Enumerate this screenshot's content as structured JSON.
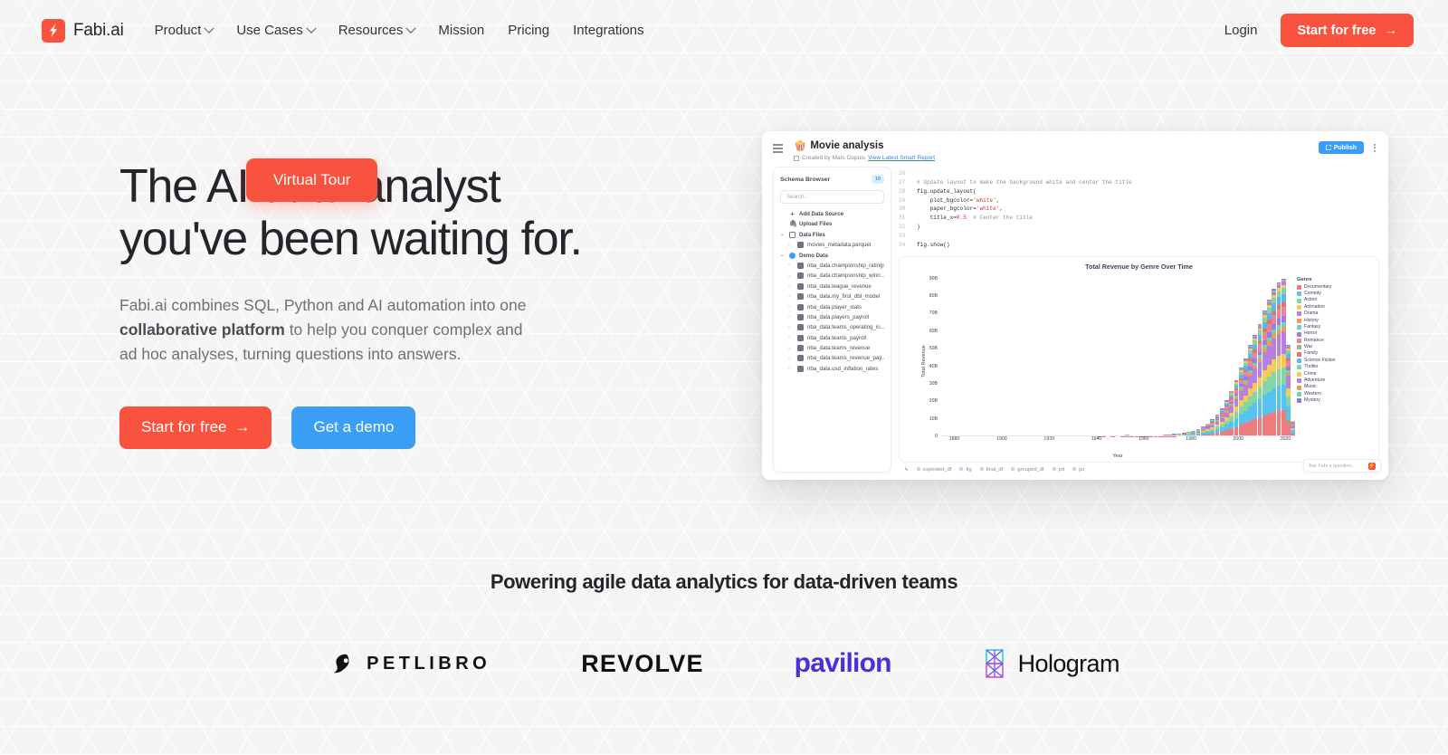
{
  "brand": {
    "name": "Fabi.ai",
    "mark_icon": "lightning-bolt-icon",
    "accent": "#f9523f"
  },
  "nav": {
    "links": [
      {
        "label": "Product",
        "has_caret": true
      },
      {
        "label": "Use Cases",
        "has_caret": true
      },
      {
        "label": "Resources",
        "has_caret": true
      },
      {
        "label": "Mission",
        "has_caret": false
      },
      {
        "label": "Pricing",
        "has_caret": false
      },
      {
        "label": "Integrations",
        "has_caret": false
      }
    ],
    "login_label": "Login",
    "cta_label": "Start for free",
    "cta_arrow": "→"
  },
  "hero": {
    "headline_line1": "The AI data analyst",
    "headline_line2": "you've been waiting for.",
    "sub_part1": "Fabi.ai combines SQL, Python and AI automation into one ",
    "sub_bold": "collaborative platform",
    "sub_part2": " to help you conquer complex and ad hoc analyses, turning questions into answers.",
    "primary_cta": "Start for free",
    "primary_cta_arrow": "→",
    "secondary_cta": "Get a demo"
  },
  "app": {
    "title": "Movie analysis",
    "title_emoji": "🍿",
    "created_by": "Created by Marc Dupuis",
    "report_link": "View Latest Smart Report",
    "publish_label": "Publish",
    "menu_icon": "hamburger-icon",
    "kebab_icon": "more-vertical-icon",
    "schema": {
      "heading": "Schema Browser",
      "badge": "10",
      "search_placeholder": "Search...",
      "tree": [
        {
          "label": "Add Data Source",
          "icon": "plus-icon",
          "type": "action",
          "indent": 0
        },
        {
          "label": "Upload Files",
          "icon": "paperclip-icon",
          "type": "action",
          "indent": 0
        },
        {
          "label": "Data Files",
          "icon": "file-icon",
          "type": "group",
          "indent": 0,
          "expanded": true
        },
        {
          "label": "movies_metadata.parquet",
          "icon": "table-icon",
          "type": "table",
          "indent": 1
        },
        {
          "label": "Demo Data",
          "icon": "database-icon",
          "type": "group",
          "indent": 0,
          "expanded": true
        },
        {
          "label": "nba_data.championship_ratings",
          "icon": "table-icon",
          "type": "table",
          "indent": 1
        },
        {
          "label": "nba_data.championship_winn...",
          "icon": "table-icon",
          "type": "table",
          "indent": 1
        },
        {
          "label": "nba_data.league_revenue",
          "icon": "table-icon",
          "type": "table",
          "indent": 1
        },
        {
          "label": "nba_data.my_first_dbt_model",
          "icon": "table-icon",
          "type": "table",
          "indent": 1
        },
        {
          "label": "nba_data.player_stats",
          "icon": "table-icon",
          "type": "table",
          "indent": 1
        },
        {
          "label": "nba_data.players_payroll",
          "icon": "table-icon",
          "type": "table",
          "indent": 1
        },
        {
          "label": "nba_data.teams_operating_in...",
          "icon": "table-icon",
          "type": "table",
          "indent": 1
        },
        {
          "label": "nba_data.teams_payroll",
          "icon": "table-icon",
          "type": "table",
          "indent": 1
        },
        {
          "label": "nba_data.teams_revenue",
          "icon": "table-icon",
          "type": "table",
          "indent": 1
        },
        {
          "label": "nba_data.teams_revenue_pay...",
          "icon": "table-icon",
          "type": "table",
          "indent": 1
        },
        {
          "label": "nba_data.usd_inflation_rates",
          "icon": "table-icon",
          "type": "table",
          "indent": 1
        }
      ]
    },
    "code_lines": [
      {
        "n": "26",
        "segments": []
      },
      {
        "n": "27",
        "segments": [
          {
            "t": "# Update layout to make the background white and center the title",
            "c": "cc"
          }
        ]
      },
      {
        "n": "28",
        "segments": [
          {
            "t": "fig.update_layout(",
            "c": "cp"
          }
        ]
      },
      {
        "n": "29",
        "segments": [
          {
            "t": "    plot_bgcolor=",
            "c": "cp"
          },
          {
            "t": "'white'",
            "c": "cs"
          },
          {
            "t": ",",
            "c": "cp"
          }
        ]
      },
      {
        "n": "30",
        "segments": [
          {
            "t": "    paper_bgcolor=",
            "c": "cp"
          },
          {
            "t": "'white'",
            "c": "cs"
          },
          {
            "t": ",",
            "c": "cp"
          }
        ]
      },
      {
        "n": "31",
        "segments": [
          {
            "t": "    title_x=",
            "c": "cp"
          },
          {
            "t": "0.5",
            "c": "cn"
          },
          {
            "t": "  # Center the title",
            "c": "cc"
          }
        ]
      },
      {
        "n": "32",
        "segments": [
          {
            "t": ")",
            "c": "cp"
          }
        ]
      },
      {
        "n": "33",
        "segments": []
      },
      {
        "n": "34",
        "segments": [
          {
            "t": "fig.show()",
            "c": "cp"
          }
        ]
      }
    ],
    "variables": [
      "exploded_df",
      "fig",
      "final_df",
      "grouped_df",
      "pd",
      "px"
    ],
    "ask_placeholder": "Ask Fabi a question...",
    "virtual_tour_label": "Virtual Tour"
  },
  "chart_data": {
    "type": "bar",
    "stacked": true,
    "title": "Total Revenue by Genre Over Time",
    "xlabel": "Year",
    "ylabel": "Total Revenue",
    "legend_title": "Genre",
    "legend_position": "right",
    "grid": false,
    "xlim": [
      1874,
      2024
    ],
    "ylim": [
      0,
      90
    ],
    "ytick_labels": [
      "0",
      "10B",
      "20B",
      "30B",
      "40B",
      "50B",
      "60B",
      "70B",
      "80B",
      "90B"
    ],
    "ytick_values": [
      0,
      10,
      20,
      30,
      40,
      50,
      60,
      70,
      80,
      90
    ],
    "xtick_labels": [
      "1880",
      "1900",
      "1920",
      "1940",
      "1960",
      "1980",
      "2000",
      "2020"
    ],
    "xtick_values": [
      1880,
      1900,
      1920,
      1940,
      1960,
      1980,
      2000,
      2020
    ],
    "series": [
      {
        "name": "Documentary",
        "color": "#ef7c7c"
      },
      {
        "name": "Comedy",
        "color": "#57c3f0"
      },
      {
        "name": "Action",
        "color": "#85d6a5"
      },
      {
        "name": "Animation",
        "color": "#f4cc55"
      },
      {
        "name": "Drama",
        "color": "#b97fe0"
      },
      {
        "name": "History",
        "color": "#f09a4e"
      },
      {
        "name": "Fantasy",
        "color": "#6ed2c0"
      },
      {
        "name": "Horror",
        "color": "#9b7ce0"
      },
      {
        "name": "Romance",
        "color": "#f07fa0"
      },
      {
        "name": "War",
        "color": "#b6a79c"
      },
      {
        "name": "Family",
        "color": "#f07060"
      },
      {
        "name": "Science Fiction",
        "color": "#5bb8ef"
      },
      {
        "name": "Thriller",
        "color": "#7fd4a8"
      },
      {
        "name": "Crime",
        "color": "#f4cc55"
      },
      {
        "name": "Adventure",
        "color": "#b97fe0"
      },
      {
        "name": "Music",
        "color": "#f0994e"
      },
      {
        "name": "Western",
        "color": "#6ed2c0"
      },
      {
        "name": "Mystery",
        "color": "#8f7ae0"
      }
    ],
    "x": [
      1874,
      1876,
      1878,
      1880,
      1882,
      1884,
      1886,
      1888,
      1890,
      1892,
      1894,
      1896,
      1898,
      1900,
      1902,
      1904,
      1906,
      1908,
      1910,
      1912,
      1914,
      1916,
      1918,
      1920,
      1922,
      1924,
      1926,
      1928,
      1930,
      1932,
      1934,
      1936,
      1938,
      1940,
      1942,
      1944,
      1946,
      1948,
      1950,
      1952,
      1954,
      1956,
      1958,
      1960,
      1962,
      1964,
      1966,
      1968,
      1970,
      1972,
      1974,
      1976,
      1978,
      1980,
      1982,
      1984,
      1986,
      1988,
      1990,
      1992,
      1994,
      1996,
      1998,
      2000,
      2002,
      2004,
      2006,
      2008,
      2010,
      2012,
      2014,
      2016,
      2018,
      2020,
      2022
    ],
    "totals": [
      0,
      0,
      0,
      0,
      0,
      0,
      0,
      0,
      0,
      0,
      0,
      0,
      0,
      0,
      0,
      0,
      0,
      0,
      0,
      0,
      0,
      0,
      0,
      0,
      0,
      0,
      0,
      0,
      0,
      0,
      0,
      0,
      0,
      0.4,
      0.3,
      0.2,
      0.3,
      0.2,
      0.3,
      0.9,
      0.4,
      0.3,
      0.4,
      0.5,
      0.6,
      0.7,
      0.8,
      1.0,
      1.2,
      1.5,
      1.8,
      2.2,
      2.6,
      3.3,
      4.2,
      5.6,
      7.4,
      9.6,
      12.5,
      15.8,
      20.5,
      26.0,
      32.0,
      39.0,
      44.5,
      52.0,
      58.0,
      64.0,
      72.0,
      78.0,
      84.0,
      88.0,
      90.0,
      52.0,
      9.0
    ]
  },
  "logos_section": {
    "title": "Powering agile data analytics for data-driven teams",
    "logos": [
      {
        "name": "PETLIBRO",
        "icon": "petlibro-pet-mark"
      },
      {
        "name": "REVOLVE",
        "icon": "revolve-wordmark"
      },
      {
        "name": "pavilion",
        "icon": "pavilion-wordmark",
        "color": "#4b2fd6"
      },
      {
        "name": "Hologram",
        "icon": "hologram-prism-mark"
      }
    ]
  }
}
